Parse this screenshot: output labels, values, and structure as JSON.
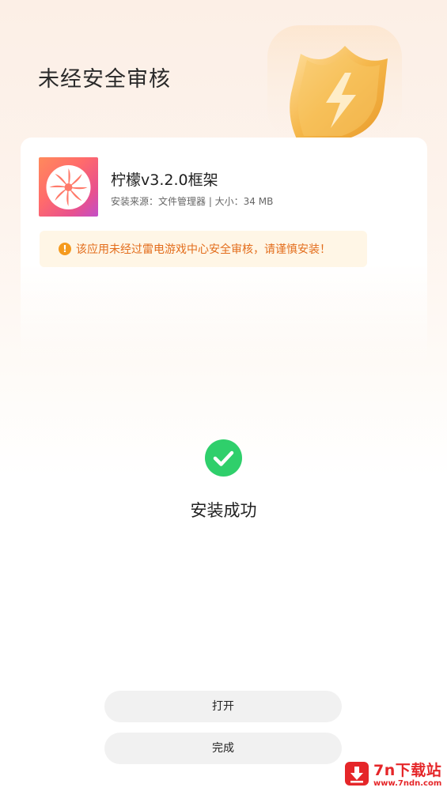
{
  "header": {
    "title": "未经安全审核"
  },
  "app": {
    "name": "柠檬v3.2.0框架",
    "meta": "安装来源：文件管理器 | 大小：34 MB",
    "icon": "lemon-slice-icon"
  },
  "warning": {
    "icon_symbol": "!",
    "text": "该应用未经过雷电游戏中心安全审核，请谨慎安装！"
  },
  "status": {
    "text": "安装成功"
  },
  "buttons": {
    "open_label": "打开",
    "done_label": "完成"
  },
  "watermark": {
    "main": "7n下载站",
    "sub": "www.7ndn.com"
  },
  "colors": {
    "success": "#2fcf6b",
    "warning_text": "#e36d1c",
    "warning_bg": "#fff6e6",
    "shield_gold": "#f2b84b",
    "watermark_red": "#e52629"
  }
}
